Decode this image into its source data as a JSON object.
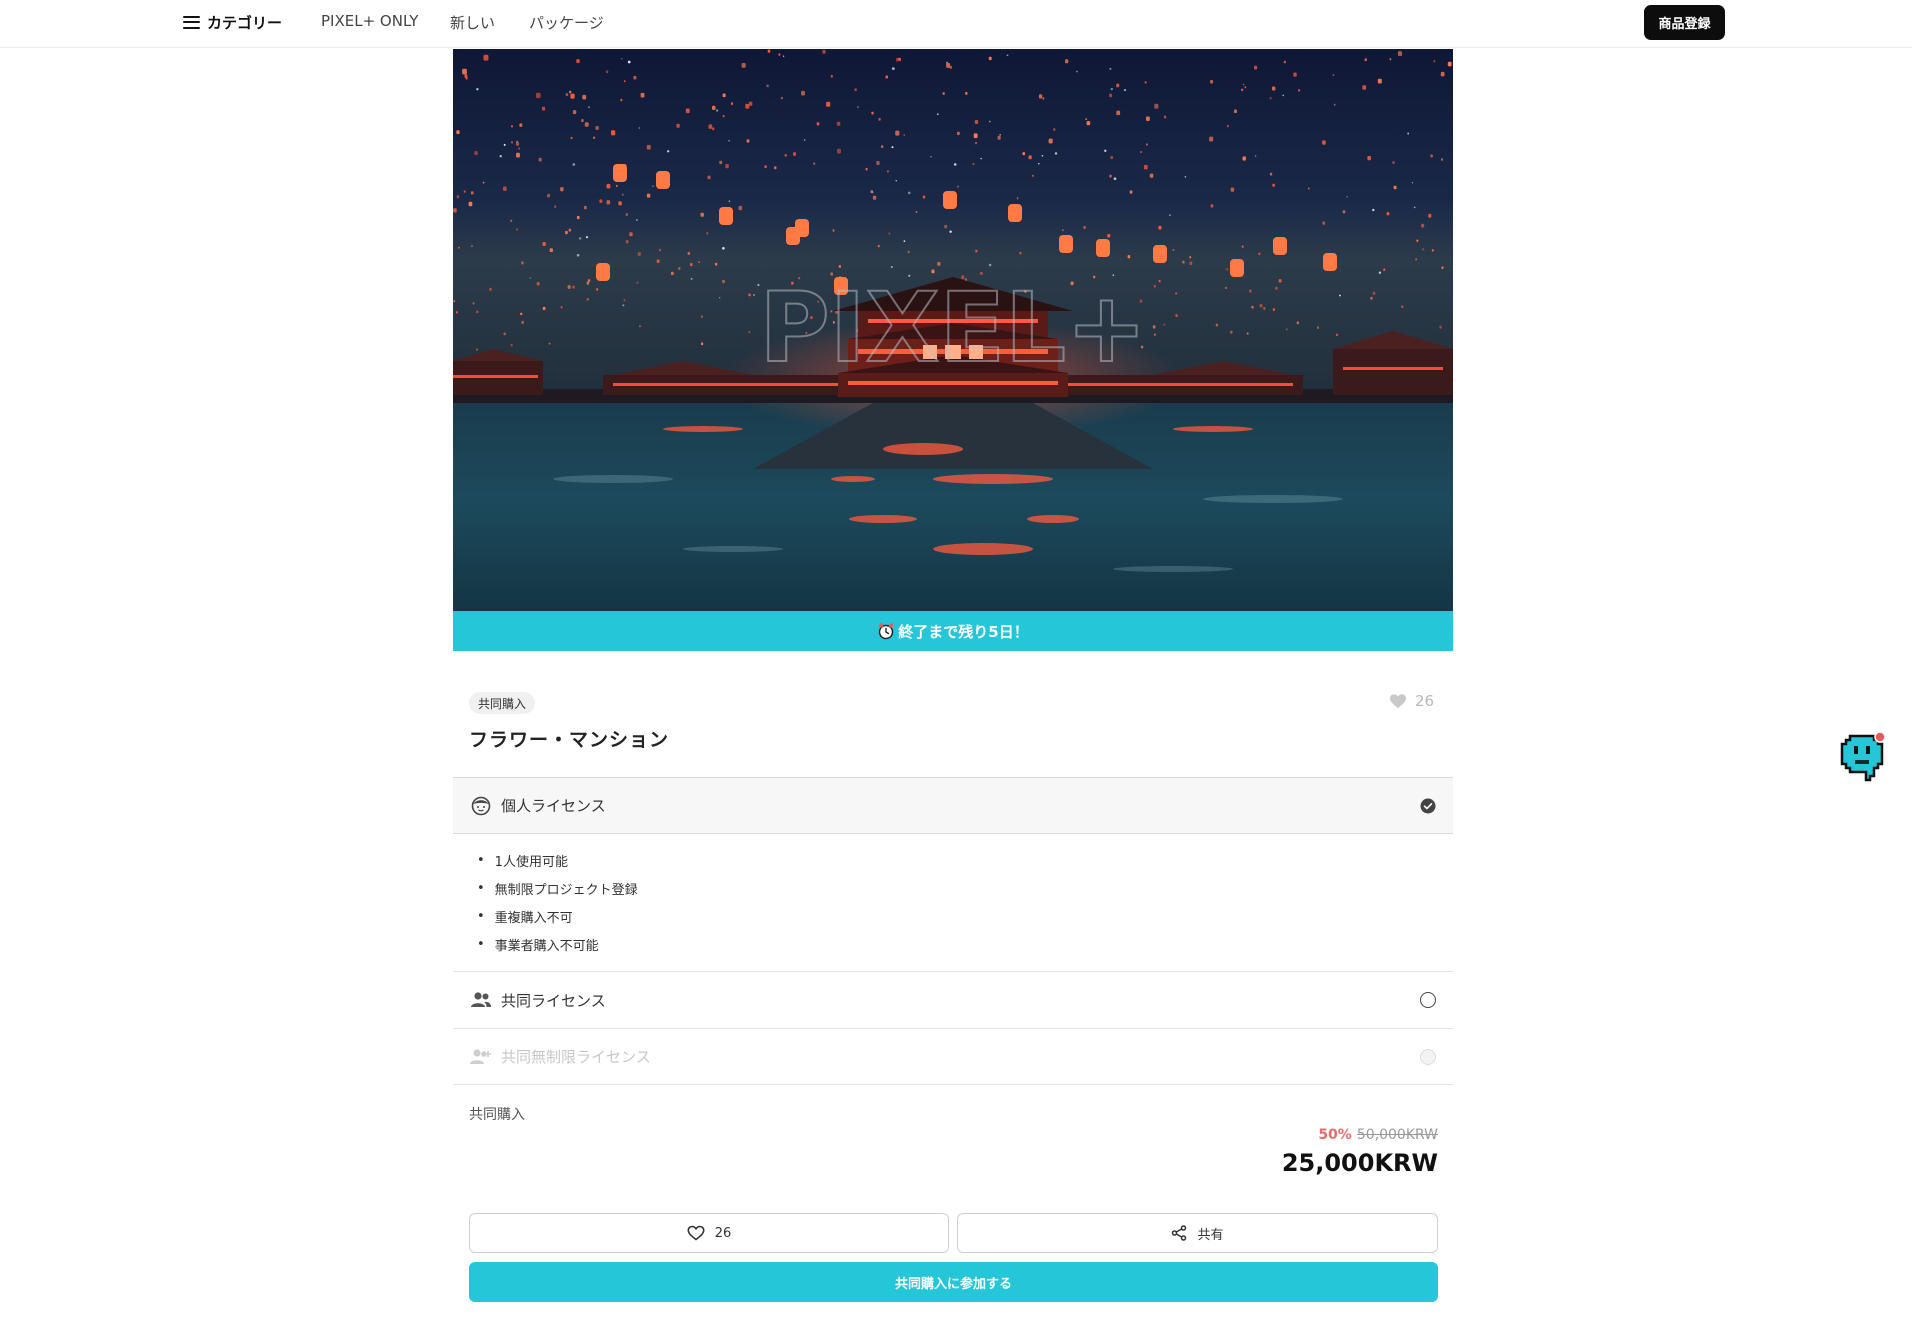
{
  "nav": {
    "category_label": "カテゴリー",
    "links": [
      "PIXEL+ ONLY",
      "新しい",
      "パッケージ"
    ],
    "register_label": "商品登録"
  },
  "hero": {
    "watermark": "PIXEL+",
    "banner_text": "終了まで残り5日！"
  },
  "product": {
    "tag": "共同購入",
    "title": "フラワー・マンション",
    "like_count": "26"
  },
  "licenses": {
    "personal": {
      "label": "個人ライセンス",
      "features": [
        "1人使用可能",
        "無制限プロジェクト登録",
        "重複購入不可",
        "事業者購入不可能"
      ]
    },
    "shared": {
      "label": "共同ライセンス"
    },
    "unlimited": {
      "label": "共同無制限ライセンス"
    }
  },
  "price": {
    "label": "共同購入",
    "discount": "50%",
    "original": "50,000KRW",
    "current": "25,000KRW"
  },
  "actions": {
    "like_count": "26",
    "share_label": "共有",
    "join_label": "共同購入に参加する"
  },
  "colors": {
    "accent": "#26c6d9",
    "discount": "#e86c6c",
    "dark_button": "#0d0d0d"
  }
}
